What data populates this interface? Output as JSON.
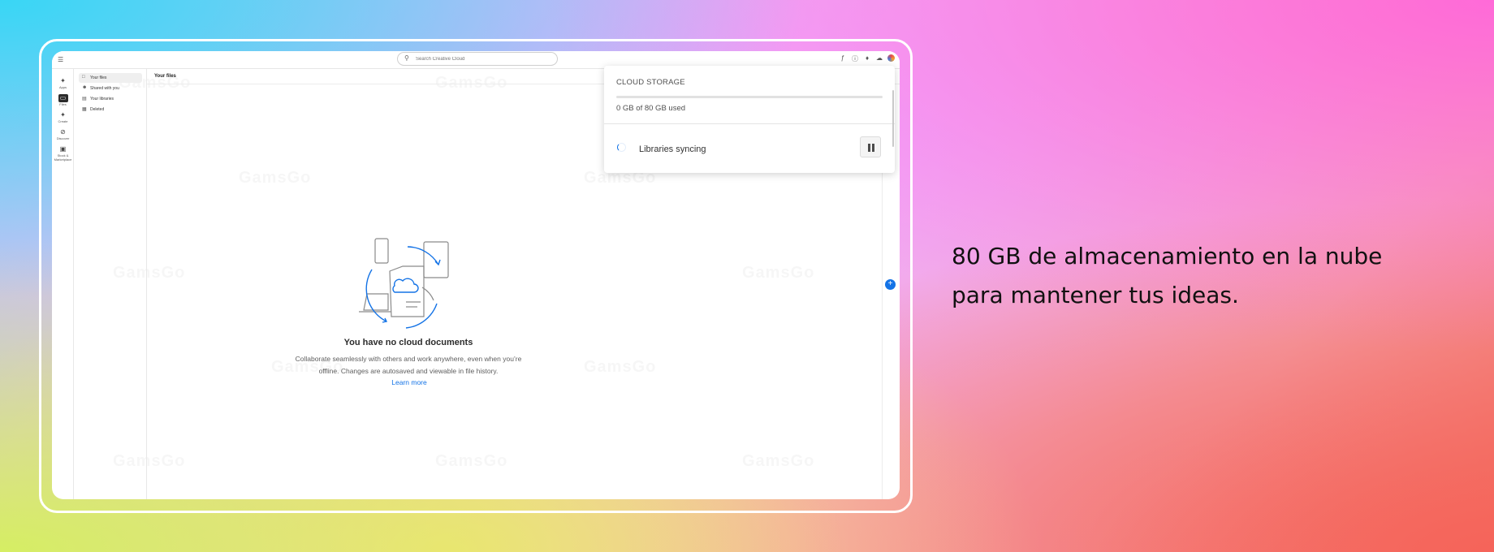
{
  "headline": "80 GB de almacenamiento en la nube para mantener tus ideas.",
  "app": {
    "search_placeholder": "Search Creative Cloud",
    "watermark": "GamsGo",
    "rail": [
      {
        "label": "Apps",
        "icon": "apps-icon"
      },
      {
        "label": "Files",
        "icon": "files-icon",
        "active": true
      },
      {
        "label": "Create",
        "icon": "create-icon"
      },
      {
        "label": "Discover",
        "icon": "discover-icon"
      },
      {
        "label": "Stock & Marketplace",
        "icon": "stock-icon"
      }
    ],
    "sidenav": [
      {
        "label": "Your files",
        "selected": true
      },
      {
        "label": "Shared with you"
      },
      {
        "label": "Your libraries"
      },
      {
        "label": "Deleted"
      }
    ],
    "main": {
      "title": "Your files",
      "empty_title": "You have no cloud documents",
      "empty_desc_1": "Collaborate seamlessly with others and work anywhere, even when you’re",
      "empty_desc_2": "offline. Changes are autosaved and viewable in file history.",
      "learn_more": "Learn more"
    },
    "storage_popover": {
      "title": "CLOUD STORAGE",
      "used_text": "0 GB of 80 GB used",
      "used_fraction": 0.0,
      "sync_text": "Libraries syncing"
    },
    "accent_color": "#1473e6"
  }
}
